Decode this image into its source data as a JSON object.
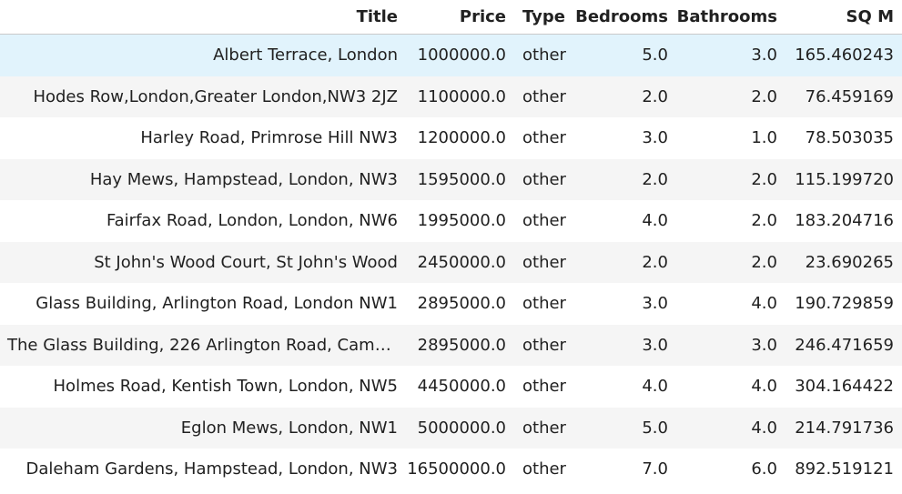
{
  "columns": {
    "title": "Title",
    "price": "Price",
    "type": "Type",
    "bedrooms": "Bedrooms",
    "bathrooms": "Bathrooms",
    "sqm": "SQ M"
  },
  "rows": [
    {
      "title": "Albert Terrace, London",
      "price": "1000000.0",
      "type": "other",
      "bedrooms": "5.0",
      "bathrooms": "3.0",
      "sqm": "165.460243"
    },
    {
      "title": "Hodes Row,London,Greater London,NW3 2JZ",
      "price": "1100000.0",
      "type": "other",
      "bedrooms": "2.0",
      "bathrooms": "2.0",
      "sqm": "76.459169"
    },
    {
      "title": "Harley Road, Primrose Hill NW3",
      "price": "1200000.0",
      "type": "other",
      "bedrooms": "3.0",
      "bathrooms": "1.0",
      "sqm": "78.503035"
    },
    {
      "title": "Hay Mews, Hampstead, London, NW3",
      "price": "1595000.0",
      "type": "other",
      "bedrooms": "2.0",
      "bathrooms": "2.0",
      "sqm": "115.199720"
    },
    {
      "title": "Fairfax Road, London, London, NW6",
      "price": "1995000.0",
      "type": "other",
      "bedrooms": "4.0",
      "bathrooms": "2.0",
      "sqm": "183.204716"
    },
    {
      "title": "St John's Wood Court, St John's Wood",
      "price": "2450000.0",
      "type": "other",
      "bedrooms": "2.0",
      "bathrooms": "2.0",
      "sqm": "23.690265"
    },
    {
      "title": "Glass Building, Arlington Road, London NW1",
      "price": "2895000.0",
      "type": "other",
      "bedrooms": "3.0",
      "bathrooms": "4.0",
      "sqm": "190.729859"
    },
    {
      "title": "The Glass Building, 226 Arlington Road, Camden...",
      "price": "2895000.0",
      "type": "other",
      "bedrooms": "3.0",
      "bathrooms": "3.0",
      "sqm": "246.471659"
    },
    {
      "title": "Holmes Road, Kentish Town, London, NW5",
      "price": "4450000.0",
      "type": "other",
      "bedrooms": "4.0",
      "bathrooms": "4.0",
      "sqm": "304.164422"
    },
    {
      "title": "Eglon Mews, London, NW1",
      "price": "5000000.0",
      "type": "other",
      "bedrooms": "5.0",
      "bathrooms": "4.0",
      "sqm": "214.791736"
    },
    {
      "title": "Daleham Gardens, Hampstead, London, NW3",
      "price": "16500000.0",
      "type": "other",
      "bedrooms": "7.0",
      "bathrooms": "6.0",
      "sqm": "892.519121"
    }
  ],
  "colors": {
    "header_border": "#c9c9c9",
    "row_stripe": "#f5f5f5",
    "row_hover": "#e1f3fc",
    "text": "#212121"
  }
}
